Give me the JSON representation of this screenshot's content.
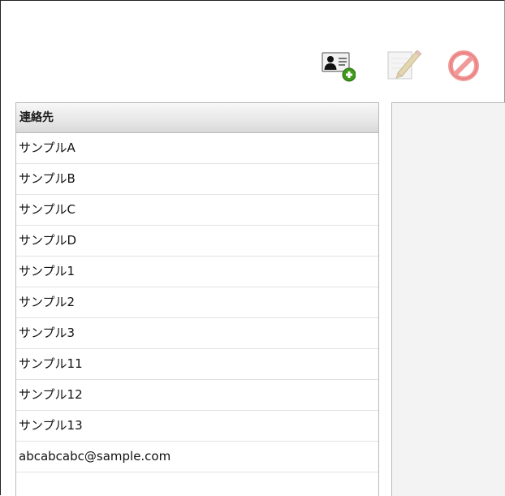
{
  "toolbar": {
    "add_contact_icon": "add-contact-icon",
    "edit_icon": "pencil-note-icon",
    "delete_icon": "no-entry-icon"
  },
  "contacts_panel": {
    "header": "連絡先",
    "items": [
      {
        "label": "サンプルA"
      },
      {
        "label": "サンプルB"
      },
      {
        "label": "サンプルC"
      },
      {
        "label": "サンプルD"
      },
      {
        "label": "サンプル1"
      },
      {
        "label": "サンプル2"
      },
      {
        "label": "サンプル3"
      },
      {
        "label": "サンプル11"
      },
      {
        "label": "サンプル12"
      },
      {
        "label": "サンプル13"
      },
      {
        "label": "abcabcabc@sample.com"
      }
    ]
  },
  "colors": {
    "add_badge_green": "#3f9a1c",
    "delete_red": "#e84a4a",
    "panel_border": "#b9b9b9",
    "detail_background": "#f3f3f3"
  }
}
